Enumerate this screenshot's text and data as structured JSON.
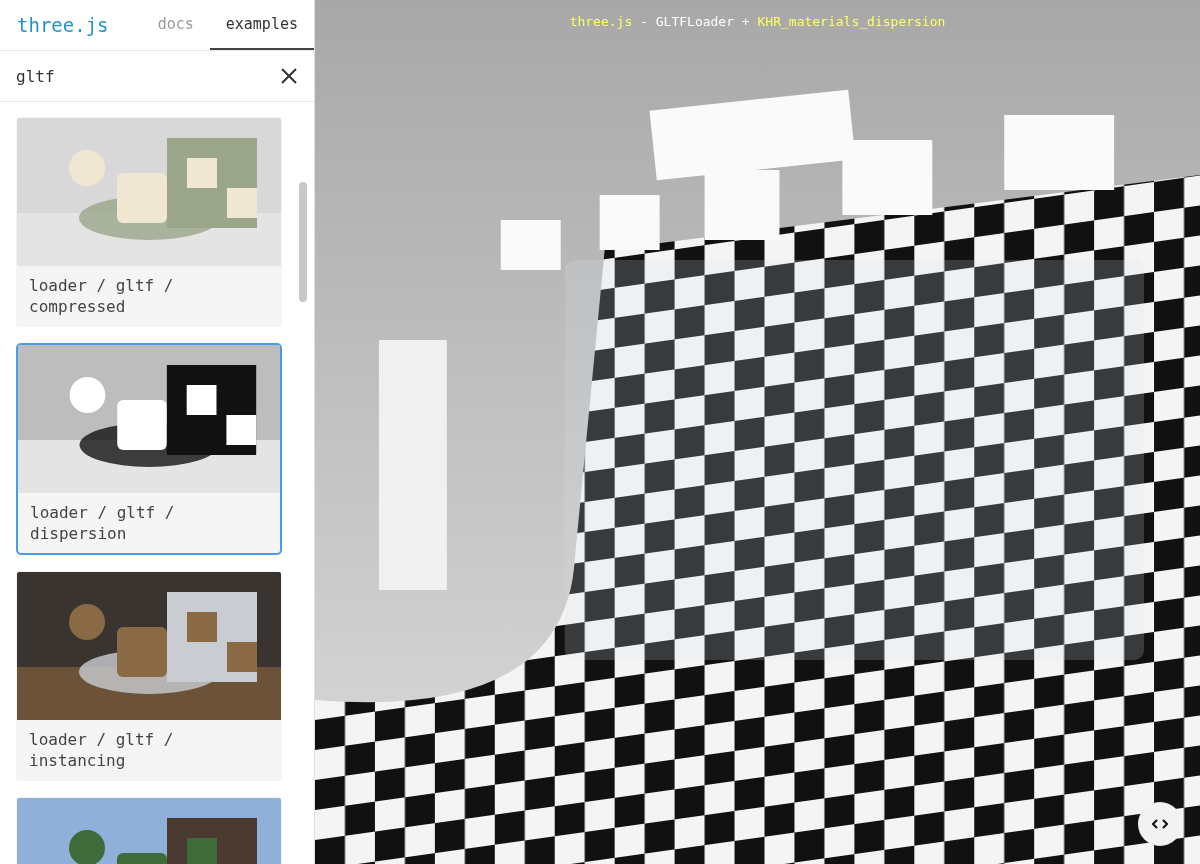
{
  "sidebar": {
    "logo": "three.js",
    "tabs": [
      {
        "label": "docs",
        "selected": false
      },
      {
        "label": "examples",
        "selected": true
      }
    ],
    "search": {
      "value": "gltf"
    },
    "examples": [
      {
        "kind": "picture",
        "title": "loader / gltf / compressed",
        "selected": false
      },
      {
        "kind": "picture",
        "title": "loader / gltf / dispersion",
        "selected": true
      },
      {
        "kind": "picture",
        "title": "loader / gltf / instancing",
        "selected": false
      },
      {
        "kind": "picture",
        "selected": false
      }
    ]
  },
  "viewer": {
    "info": [
      {
        "kind": "link",
        "text": "three.js"
      },
      {
        "kind": "text",
        "text": " - GLTFLoader + "
      },
      {
        "kind": "link",
        "text": "KHR_materials_dispersion"
      }
    ]
  }
}
